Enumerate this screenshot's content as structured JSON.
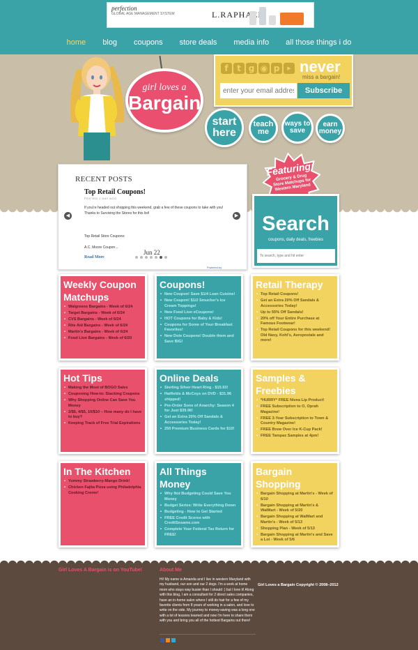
{
  "ad": {
    "left_brand": "perfection",
    "left_tagline": "GLOBAL AGE MANAGEMENT SYSTEM",
    "brand": "L.RAPHAEL"
  },
  "nav": {
    "items": [
      {
        "label": "home",
        "active": true
      },
      {
        "label": "blog"
      },
      {
        "label": "coupons"
      },
      {
        "label": "store deals"
      },
      {
        "label": "media info"
      },
      {
        "label": "all those things i do"
      }
    ]
  },
  "logo": {
    "line1": "girl loves a",
    "line2": "Bargain"
  },
  "subscribe": {
    "never": "never",
    "never_sub": "miss a bargain!",
    "email_placeholder": "enter your email address",
    "button": "Subscribe",
    "social_icons": [
      "facebook-icon",
      "twitter-icon",
      "google-plus-icon",
      "rss-icon",
      "pinterest-icon",
      "youtube-icon"
    ]
  },
  "circle_buttons": {
    "start": "start here",
    "teach": "teach me",
    "ways": "ways to save",
    "earn": "earn money"
  },
  "recent_posts": {
    "heading": "RECENT POSTS",
    "post_title": "Top Retail Coupons!",
    "posted": "POSTED 1 DAY AGO",
    "excerpt": "If you're headed out shopping this weekend, grab a few of these coupons to take with you! Thanks to Surviving the Stores for this list!",
    "list_line1": "Top Retail Store Coupons:",
    "list_line2": "A.C. Moore Coupon...",
    "date": "Jun 22",
    "read_more": "Read More",
    "powered": "Powered by",
    "dots": 7,
    "active_dot": 5
  },
  "featuring": {
    "title": "Featuring:",
    "sub": "Grocery & Drug Store Matchups for Western Maryland"
  },
  "search": {
    "title": "Search",
    "sub": "coupons, daily deals, freebies",
    "placeholder": "To search, type and hit enter"
  },
  "boxes": [
    {
      "title": "Weekly Coupon Matchups",
      "color": "#e9506c",
      "items": [
        "Walgreens Bargains - Week of 6/24",
        "Target Bargains - Week of 6/24",
        "CVS Bargains - Week of 6/24",
        "Rite Aid Bargains - Week of 6/24",
        "Martin's Bargains - Week of 6/24",
        "Food Lion Bargains - Week of 6/20"
      ]
    },
    {
      "title": "Coupons!",
      "color": "#3aa3a8",
      "items": [
        "New Coupon! Save $1/4 Lean Cuisine!",
        "New Coupon! $1/2 Smucker's Ice Cream Toppings!",
        "New Food Lion eCoupons!",
        "HOT Coupons for Baby & Kids!",
        "Coupons for Some of Your Breakfast Favorites!",
        "New Dole Coupons! Double them and Save BIG!"
      ]
    },
    {
      "title": "Retail Therapy",
      "color": "#f2d35f",
      "items": [
        "Top Retail Coupons!",
        "Get an Extra 20% Off Sandals & Accessories Today!",
        "Up to 55% Off Sandals!",
        "20% off Your Entire Purchase at Famous Footwear!",
        "Top Retail Coupons for this weekend! Old Navy, Kohl's, Aeropostale and more!"
      ]
    },
    {
      "title": "Hot Tips",
      "color": "#e9506c",
      "items": [
        "Making the Most of BOGO Sales",
        "Couponing How-to: Stacking Coupons",
        "Why Shopping Online Can Save You Money",
        "2/$5, 4/$5, 10/$10 – How many do I have to buy?",
        "Keeping Track of Free Trial Expirations"
      ]
    },
    {
      "title": "Online Deals",
      "color": "#3aa3a8",
      "items": [
        "Sterling Silver Heart Ring - $15.93!",
        "Hatfields & McCoys on DVD - $31.96 shipped!",
        "Pre-Order Sons of Anarchy: Season 4 for Just $39.96!",
        "Get an Extra 20% Off Sandals & Accessories Today!",
        "250 Premium Business Cards for $10!"
      ]
    },
    {
      "title": "Samples & Freebies",
      "color": "#f2d35f",
      "items": [
        "*HURRY* FREE Nivea Lip Product!",
        "FREE Subscription to O, Oprah Magazine!",
        "FREE 3-Year Subscription to Town & Country Magazine!",
        "FREE Brew Over Ice K-Cup Pack!",
        "FREE Tampax Samples at 4pm!"
      ]
    },
    {
      "title": "In The Kitchen",
      "color": "#e9506c",
      "items": [
        "Yummy Strawberry-Mango Drink!",
        "Chicken Fajita Pizza using Philadelphia Cooking Creme!"
      ]
    },
    {
      "title": "All Things Money",
      "color": "#3aa3a8",
      "items": [
        "Why Not Budgeting Could Save You Money",
        "Budget Series: Write Everything Down",
        "Budgeting - How to Get Started",
        "FREE Credit Scores with CreditSesame.com",
        "Complete Your Federal Tax Return for FREE!"
      ]
    },
    {
      "title": "Bargain Shopping",
      "color": "#f2d35f",
      "items": [
        "Bargain Shopping at Martin's - Week of 6/10",
        "Bargain Shopping at Martin's & WalMart - Week of 5/20",
        "Bargain Shopping at WalMart and Martin's - Week of 5/13",
        "Shopping Plan - Week of 5/13",
        "Bargain Shopping at Martin's and Save a Lot - Week of 5/6"
      ]
    }
  ],
  "footer": {
    "youtube": "Girl Loves A Bargain is on YouTube!",
    "about_title": "About Me",
    "about_text": "Hi! My name is Amanda and I live in western Maryland with my husband, our son and our 2 dogs. I'm a work at home mom who stays way busier than I should :) but I love it! Along with this blog, I am a consultant for 2 direct sales companies, have an in-home salon where I still do hair for a few of my favorite clients from 8 years of working in a salon, and love to write on the side. My journey to money-saving was a long one with a lot of lessons learned and now I'm here to share them with you and bring you all of the hottest Bargains out there!",
    "copyright": "Girl Loves a Bargain Copyright © 2008–2012"
  }
}
